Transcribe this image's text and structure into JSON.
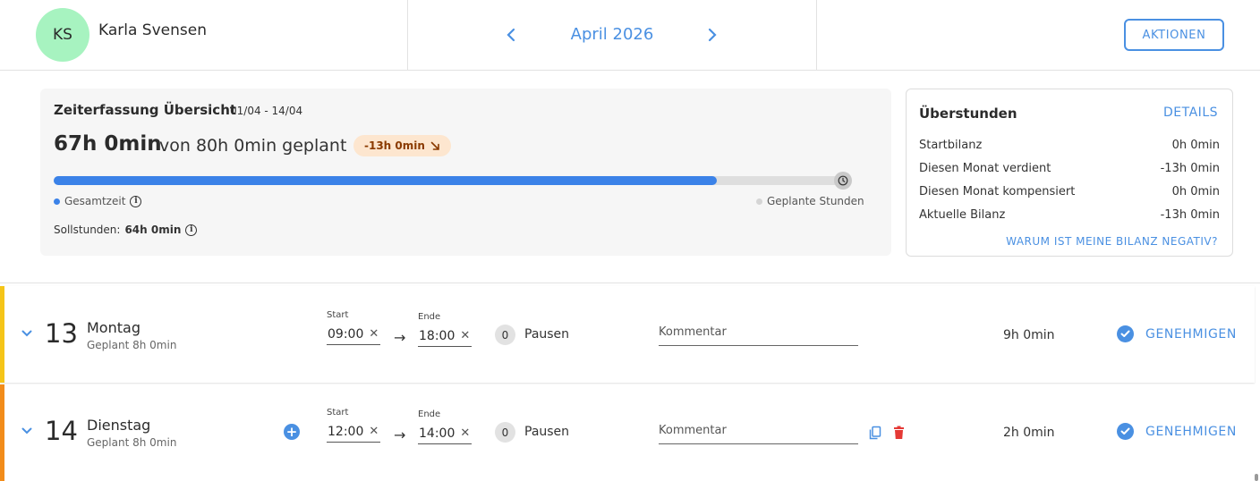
{
  "header": {
    "avatar_initials": "KS",
    "user_name": "Karla Svensen",
    "month_label": "April 2026",
    "actions_label": "AKTIONEN",
    "prev_icon": "chevron-left-icon",
    "next_icon": "chevron-right-icon"
  },
  "summary": {
    "title": "Zeiterfassung Übersicht",
    "range": "01/04 - 14/04",
    "total": "67h 0min",
    "planned_text": "von 80h 0min geplant",
    "diff_badge": "-13h 0min",
    "progress_fraction": 0.8375,
    "legend_total": "Gesamtzeit",
    "legend_planned": "Geplante Stunden",
    "target_label": "Sollstunden:",
    "target_value": "64h 0min",
    "colors": {
      "fill": "#3b82e8",
      "badge_bg": "#fde6cf"
    }
  },
  "overtime": {
    "title": "Überstunden",
    "details_label": "DETAILS",
    "rows": [
      {
        "label": "Startbilanz",
        "value": "0h 0min"
      },
      {
        "label": "Diesen Monat verdient",
        "value": "-13h 0min"
      },
      {
        "label": "Diesen Monat kompensiert",
        "value": "0h 0min"
      },
      {
        "label": "Aktuelle Bilanz",
        "value": "-13h 0min"
      }
    ],
    "link_label": "WARUM IST MEINE BILANZ NEGATIV?"
  },
  "labels": {
    "start": "Start",
    "end": "Ende",
    "breaks": "Pausen",
    "comment_placeholder": "Kommentar",
    "approve": "GENEHMIGEN",
    "clear": "✕",
    "arrow": "→"
  },
  "days": [
    {
      "number": "13",
      "weekday": "Montag",
      "planned": "Geplant 8h 0min",
      "start": "09:00",
      "end": "18:00",
      "breaks": "0",
      "comment": "",
      "total": "9h 0min",
      "accent": "#f5c518"
    },
    {
      "number": "14",
      "weekday": "Dienstag",
      "planned": "Geplant 8h 0min",
      "start": "12:00",
      "end": "14:00",
      "breaks": "0",
      "comment": "",
      "total": "2h 0min",
      "accent": "#f28c1a"
    }
  ]
}
